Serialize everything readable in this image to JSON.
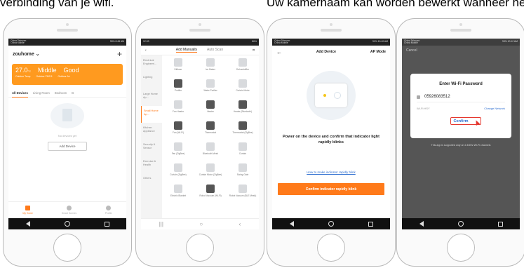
{
  "captions": {
    "left": "verbinding van je wifi.",
    "right": "Uw kamernaam kan worden bewerkt wanneer het a"
  },
  "phone1": {
    "status_left": "China Telecom\nChina Mobile",
    "status_right": "95% 8:45 AM",
    "home_name": "zouhome",
    "weather": {
      "temp": "27.0",
      "temp_unit": "°C",
      "pm": "Middle",
      "quality": "Good",
      "temp_label": "Outdoor Temp",
      "pm_label": "Outdoor PM2.5",
      "quality_label": "Outdoor Air"
    },
    "tabs": [
      "All Devices",
      "Living Room",
      "Bedroom",
      "B"
    ],
    "empty_text": "No devices yet",
    "add_button": "Add Device",
    "bottom_tabs": [
      "My Home",
      "Smart Scenes",
      "Profile"
    ]
  },
  "phone2": {
    "status_left": "12:03",
    "status_right": "86%",
    "tabs": [
      "Add Manually",
      "Auto Scan"
    ],
    "categories": [
      "Electrical Engineeri...",
      "Lighting",
      "Large Home Ap...",
      "Small Home Ap...",
      "Kitchen Appliance",
      "Security & Sensor",
      "Exercise & Health",
      "Others"
    ],
    "devices": [
      "Diffuser",
      "Ice Maker",
      "Dehumidifier",
      "Purifier",
      "Water Purifier",
      "Curtain Motor",
      "Fan Heater",
      "Heater",
      "Heater (Bluetooth)",
      "Fan (Wi-Fi)",
      "Thermostat",
      "Thermostat (ZigBee)",
      "Fan (ZigBee)",
      "Bluetooth Mesh",
      "Curtain",
      "Curtain (ZigBee)",
      "Curtain Motor (ZigBee)",
      "Swing Gate",
      "Electric Blanket",
      "Robot Vacuum (Wi-Fi)",
      "Robot Vacuum (BLE Mesh)"
    ]
  },
  "phone3": {
    "status_left": "China Telecom\nChina Mobile",
    "status_right": "91% 10:40 AM",
    "title": "Add Device",
    "mode": "AP Mode",
    "instruction": "Power on the device and confirm that indicator light rapidly blinks",
    "link": "How to make indicator rapidly blink",
    "confirm_button": "Confirm indicator rapidly blink"
  },
  "phone4": {
    "status_left": "China Telecom\nChina Mobile",
    "status_right": "93% 10:12 AM",
    "cancel": "Cancel",
    "dialog_title": "Enter Wi-Fi Password",
    "password": "05926083512",
    "wifi_label": "Wi-Fi:HSY",
    "change_network": "Change Network",
    "confirm": "Confirm",
    "note": "This app is supported only on 2.4GHz Wi-Fi channels"
  }
}
